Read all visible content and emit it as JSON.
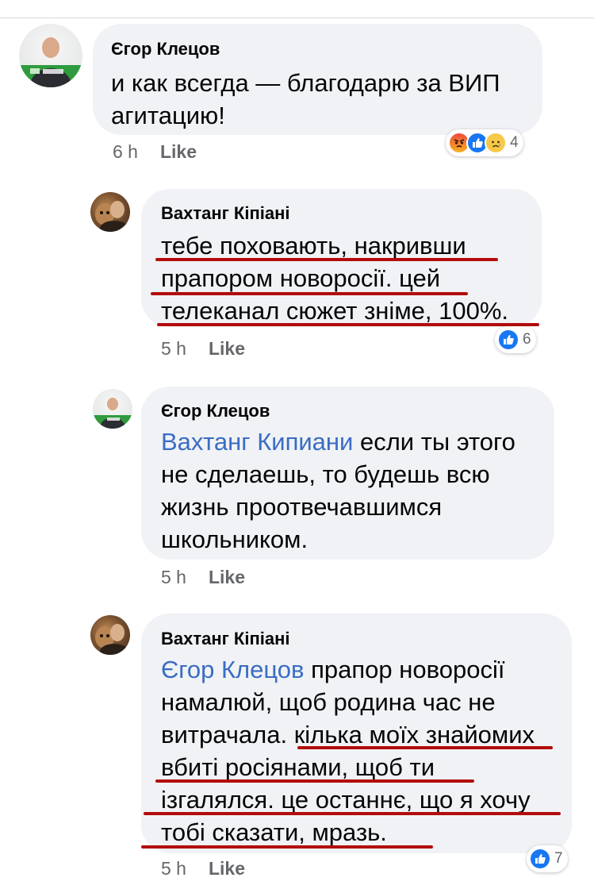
{
  "colors": {
    "bubble": "#f0f2f5",
    "mention": "#3a6cc4",
    "underline": "#b30c0c",
    "like_blue": "#1877f2"
  },
  "comments": [
    {
      "author": "Єгор Клецов",
      "lines": [
        "и как всегда — благодарю за ВИП",
        "агитацию!"
      ],
      "time": "6 h",
      "like_label": "Like",
      "reactions": {
        "icons": [
          "angry-icon",
          "like-icon",
          "sad-icon"
        ],
        "count": "4"
      }
    },
    {
      "author": "Вахтанг Кіпіані",
      "lines": [
        "тебе поховають, накривши",
        "прапором новоросії. цей",
        "телеканал сюжет зніме, 100%."
      ],
      "time": "5 h",
      "like_label": "Like",
      "reactions": {
        "icons": [
          "like-icon"
        ],
        "count": "6"
      }
    },
    {
      "author": "Єгор Клецов",
      "mention": "Вахтанг Кипиани",
      "lines": [
        " если ты этого",
        "не сделаешь, то будешь всю",
        "жизнь проотвечавшимся",
        "школьником."
      ],
      "time": "5 h",
      "like_label": "Like"
    },
    {
      "author": "Вахтанг Кіпіані",
      "mention": "Єгор Клецов",
      "lines": [
        " прапор новоросії",
        "намалюй, щоб родина час не",
        "витрачала. кілька моїх знайомих",
        "вбиті росіянами, щоб ти",
        "ізгалялся. це останнє, що я хочу",
        "тобі сказати, мразь."
      ],
      "time": "5 h",
      "like_label": "Like",
      "reactions": {
        "icons": [
          "like-icon"
        ],
        "count": "7"
      }
    }
  ]
}
